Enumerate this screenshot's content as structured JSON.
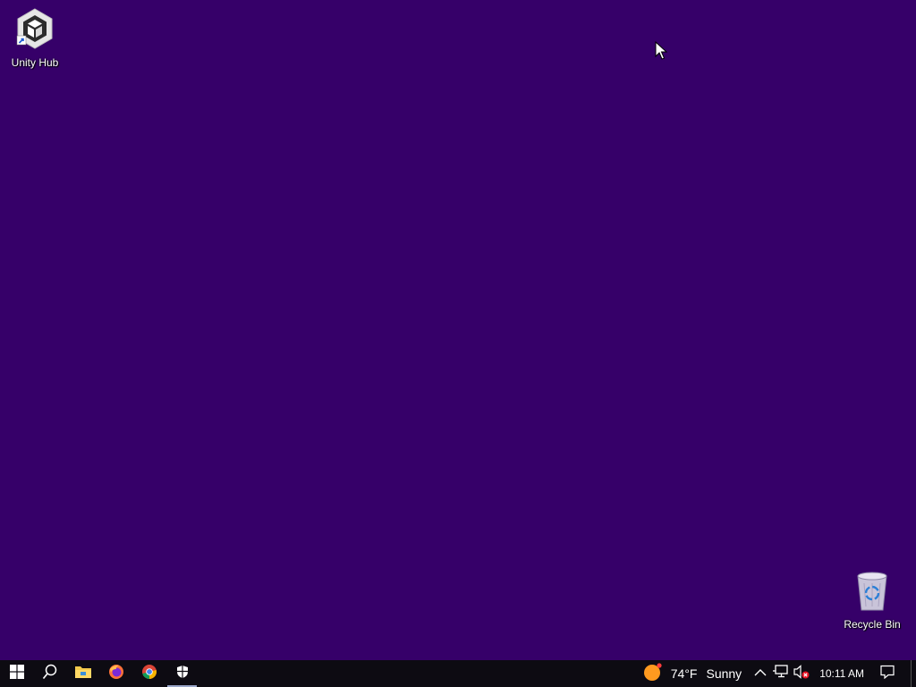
{
  "desktop": {
    "background_color": "#360069",
    "icons": [
      {
        "label": "Unity Hub",
        "icon": "unity-hub-icon"
      },
      {
        "label": "Recycle Bin",
        "icon": "recycle-bin-icon"
      }
    ]
  },
  "taskbar": {
    "buttons": [
      {
        "name": "start-button",
        "icon": "windows-logo-icon"
      },
      {
        "name": "search-button",
        "icon": "search-icon"
      },
      {
        "name": "file-explorer-button",
        "icon": "folder-icon"
      },
      {
        "name": "firefox-button",
        "icon": "firefox-icon"
      },
      {
        "name": "chrome-button",
        "icon": "chrome-icon"
      },
      {
        "name": "security-button",
        "icon": "shield-icon",
        "active": true
      }
    ],
    "weather": {
      "temperature": "74°F",
      "condition": "Sunny",
      "icon": "sun-icon"
    },
    "tray": {
      "icons": [
        "chevron-up-icon",
        "network-icon",
        "volume-muted-icon"
      ],
      "time": "10:11 AM"
    },
    "notification_icon": "action-center-icon"
  }
}
